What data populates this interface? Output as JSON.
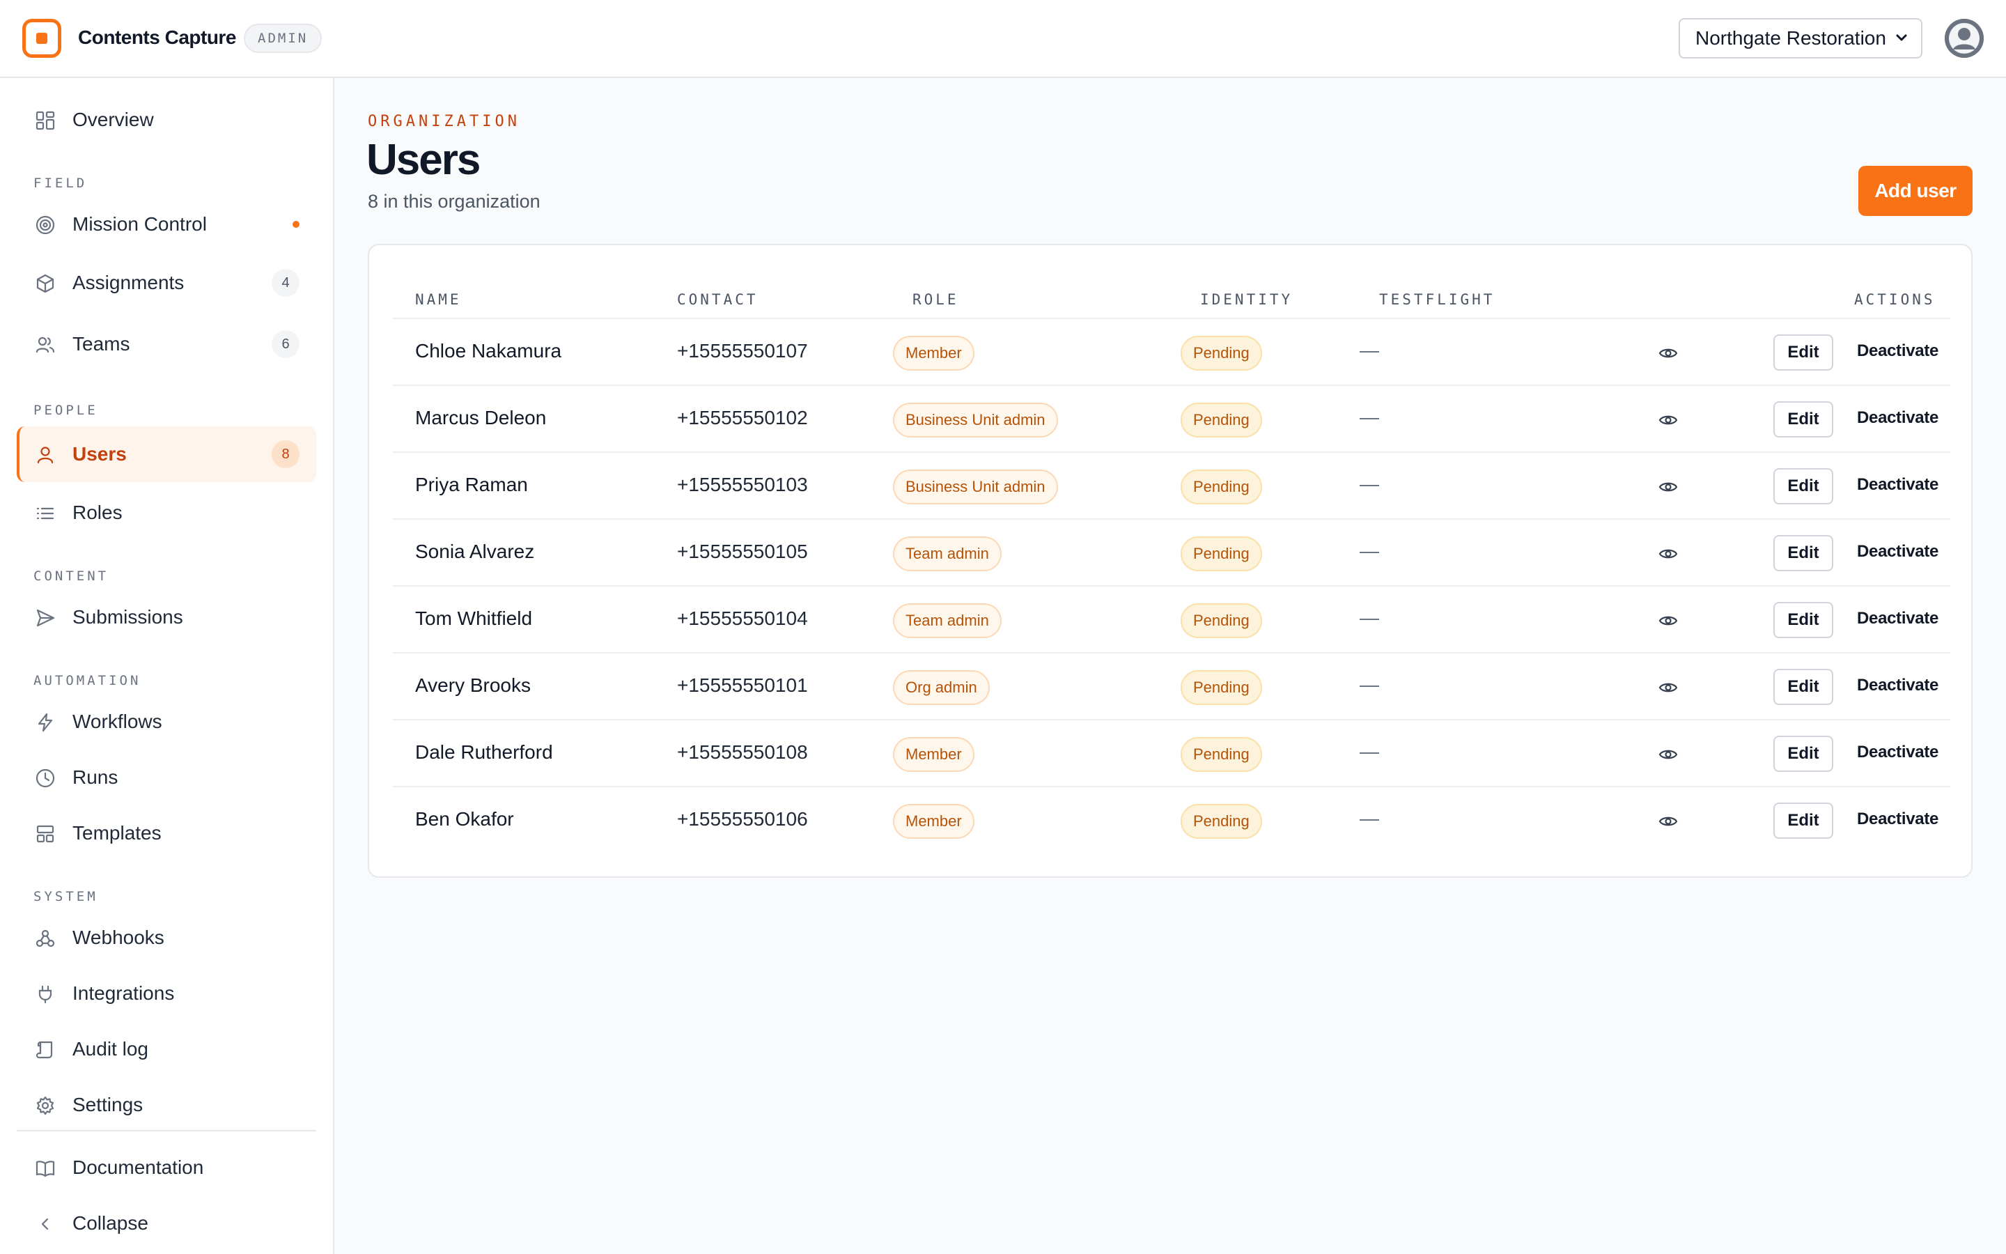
{
  "app": {
    "title": "Contents Capture",
    "badge": "ADMIN"
  },
  "header": {
    "org_select_value": "Northgate Restoration"
  },
  "sidebar": {
    "overview": "Overview",
    "sections": {
      "field": "FIELD",
      "people": "PEOPLE",
      "content": "CONTENT",
      "automation": "AUTOMATION",
      "system": "SYSTEM"
    },
    "items": {
      "mission_control": "Mission Control",
      "assignments": "Assignments",
      "assignments_count": "4",
      "teams": "Teams",
      "teams_count": "6",
      "users": "Users",
      "users_count": "8",
      "roles": "Roles",
      "submissions": "Submissions",
      "workflows": "Workflows",
      "runs": "Runs",
      "templates": "Templates",
      "webhooks": "Webhooks",
      "integrations": "Integrations",
      "audit_log": "Audit log",
      "settings": "Settings",
      "documentation": "Documentation",
      "collapse": "Collapse"
    }
  },
  "page": {
    "eyebrow": "ORGANIZATION",
    "title": "Users",
    "subtitle": "8 in this organization",
    "add_button": "Add user"
  },
  "table": {
    "columns": {
      "name": "NAME",
      "contact": "CONTACT",
      "role": "ROLE",
      "identity": "IDENTITY",
      "testflight": "TESTFLIGHT",
      "actions": "ACTIONS"
    },
    "edit_label": "Edit",
    "deactivate_label": "Deactivate",
    "rows": [
      {
        "name": "Chloe Nakamura",
        "contact": "+15555550107",
        "role": "Member",
        "identity": "Pending",
        "testflight": "—"
      },
      {
        "name": "Marcus Deleon",
        "contact": "+15555550102",
        "role": "Business Unit admin",
        "identity": "Pending",
        "testflight": "—"
      },
      {
        "name": "Priya Raman",
        "contact": "+15555550103",
        "role": "Business Unit admin",
        "identity": "Pending",
        "testflight": "—"
      },
      {
        "name": "Sonia Alvarez",
        "contact": "+15555550105",
        "role": "Team admin",
        "identity": "Pending",
        "testflight": "—"
      },
      {
        "name": "Tom Whitfield",
        "contact": "+15555550104",
        "role": "Team admin",
        "identity": "Pending",
        "testflight": "—"
      },
      {
        "name": "Avery Brooks",
        "contact": "+15555550101",
        "role": "Org admin",
        "identity": "Pending",
        "testflight": "—"
      },
      {
        "name": "Dale Rutherford",
        "contact": "+15555550108",
        "role": "Member",
        "identity": "Pending",
        "testflight": "—"
      },
      {
        "name": "Ben Okafor",
        "contact": "+15555550106",
        "role": "Member",
        "identity": "Pending",
        "testflight": "—"
      }
    ]
  },
  "colors": {
    "accent": "#f97316",
    "accent_dark": "#c2410c"
  }
}
